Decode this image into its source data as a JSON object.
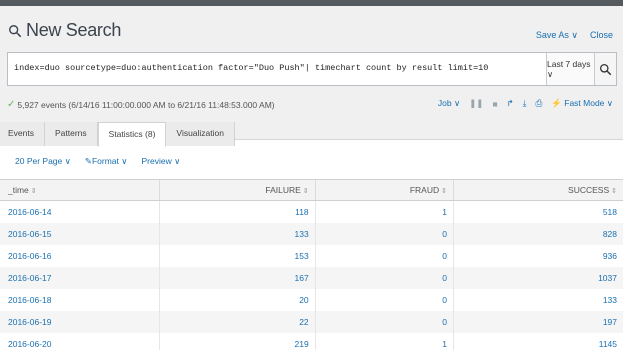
{
  "header": {
    "title": "New Search",
    "save_as": "Save As ∨",
    "close": "Close"
  },
  "search": {
    "query": "index=duo sourcetype=duo:authentication factor=\"Duo Push\"| timechart count by result limit=10",
    "time_range": "Last 7 days ∨"
  },
  "status": {
    "events": "5,927 events (6/14/16 11:00:00.000 AM to 6/21/16 11:48:53.000 AM)"
  },
  "job_tools": {
    "job": "Job ∨",
    "mode": "Fast Mode ∨"
  },
  "tabs": [
    {
      "label": "Events"
    },
    {
      "label": "Patterns"
    },
    {
      "label": "Statistics (8)"
    },
    {
      "label": "Visualization"
    }
  ],
  "viz_toolbar": {
    "per_page": "20 Per Page ∨",
    "format": "Format ∨",
    "preview": "Preview ∨"
  },
  "table": {
    "headers": [
      "_time",
      "FAILURE",
      "FRAUD",
      "SUCCESS"
    ],
    "rows": [
      [
        "2016-06-14",
        "118",
        "1",
        "518"
      ],
      [
        "2016-06-15",
        "133",
        "0",
        "828"
      ],
      [
        "2016-06-16",
        "153",
        "0",
        "936"
      ],
      [
        "2016-06-17",
        "167",
        "0",
        "1037"
      ],
      [
        "2016-06-18",
        "20",
        "0",
        "133"
      ],
      [
        "2016-06-19",
        "22",
        "0",
        "197"
      ],
      [
        "2016-06-20",
        "219",
        "1",
        "1145"
      ]
    ]
  },
  "colors": {
    "link": "#1a6fb0",
    "success_check": "#5cb85c"
  }
}
